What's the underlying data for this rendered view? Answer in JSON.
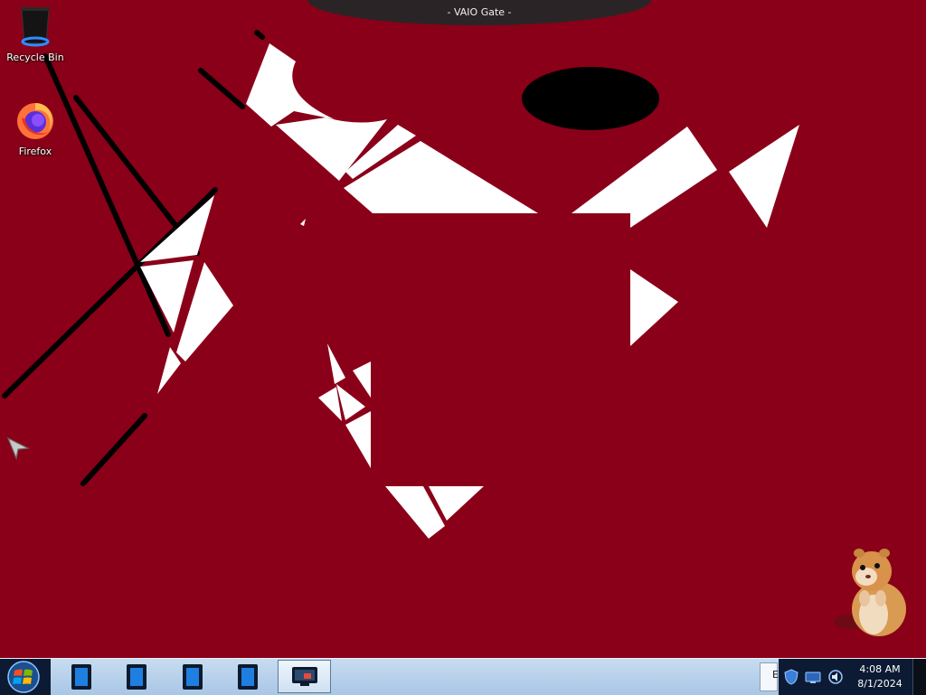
{
  "titlebar": {
    "title": "- VAIO Gate -"
  },
  "desktop": {
    "background_color": "#8a0019",
    "icons": [
      {
        "label": "Recycle Bin",
        "icon": "recycle-bin-icon"
      },
      {
        "label": "Firefox",
        "icon": "firefox-icon"
      }
    ]
  },
  "taskbar": {
    "start_icon": "windows-logo-icon",
    "pinned": [
      {
        "icon": "tablet-app-icon"
      },
      {
        "icon": "tablet-app-icon"
      },
      {
        "icon": "tablet-app-icon"
      },
      {
        "icon": "tablet-app-icon"
      },
      {
        "icon": "monitor-app-icon",
        "active": true
      }
    ],
    "tray": {
      "partial_label": "E",
      "icons": [
        "shield-icon",
        "network-icon",
        "speaker-icon"
      ],
      "time": "4:08 AM",
      "date": "8/1/2024"
    }
  }
}
